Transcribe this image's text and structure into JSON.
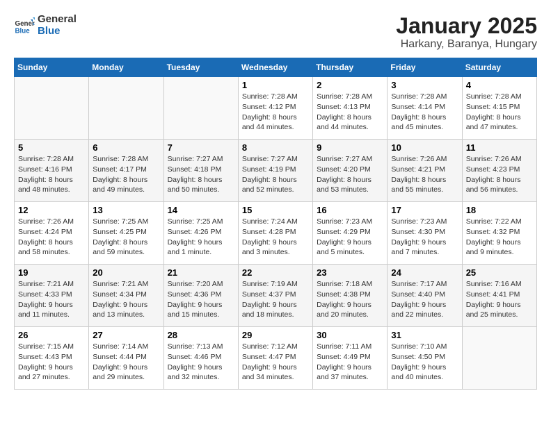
{
  "logo": {
    "line1": "General",
    "line2": "Blue"
  },
  "title": "January 2025",
  "subtitle": "Harkany, Baranya, Hungary",
  "headers": [
    "Sunday",
    "Monday",
    "Tuesday",
    "Wednesday",
    "Thursday",
    "Friday",
    "Saturday"
  ],
  "weeks": [
    [
      {
        "day": "",
        "info": ""
      },
      {
        "day": "",
        "info": ""
      },
      {
        "day": "",
        "info": ""
      },
      {
        "day": "1",
        "info": "Sunrise: 7:28 AM\nSunset: 4:12 PM\nDaylight: 8 hours\nand 44 minutes."
      },
      {
        "day": "2",
        "info": "Sunrise: 7:28 AM\nSunset: 4:13 PM\nDaylight: 8 hours\nand 44 minutes."
      },
      {
        "day": "3",
        "info": "Sunrise: 7:28 AM\nSunset: 4:14 PM\nDaylight: 8 hours\nand 45 minutes."
      },
      {
        "day": "4",
        "info": "Sunrise: 7:28 AM\nSunset: 4:15 PM\nDaylight: 8 hours\nand 47 minutes."
      }
    ],
    [
      {
        "day": "5",
        "info": "Sunrise: 7:28 AM\nSunset: 4:16 PM\nDaylight: 8 hours\nand 48 minutes."
      },
      {
        "day": "6",
        "info": "Sunrise: 7:28 AM\nSunset: 4:17 PM\nDaylight: 8 hours\nand 49 minutes."
      },
      {
        "day": "7",
        "info": "Sunrise: 7:27 AM\nSunset: 4:18 PM\nDaylight: 8 hours\nand 50 minutes."
      },
      {
        "day": "8",
        "info": "Sunrise: 7:27 AM\nSunset: 4:19 PM\nDaylight: 8 hours\nand 52 minutes."
      },
      {
        "day": "9",
        "info": "Sunrise: 7:27 AM\nSunset: 4:20 PM\nDaylight: 8 hours\nand 53 minutes."
      },
      {
        "day": "10",
        "info": "Sunrise: 7:26 AM\nSunset: 4:21 PM\nDaylight: 8 hours\nand 55 minutes."
      },
      {
        "day": "11",
        "info": "Sunrise: 7:26 AM\nSunset: 4:23 PM\nDaylight: 8 hours\nand 56 minutes."
      }
    ],
    [
      {
        "day": "12",
        "info": "Sunrise: 7:26 AM\nSunset: 4:24 PM\nDaylight: 8 hours\nand 58 minutes."
      },
      {
        "day": "13",
        "info": "Sunrise: 7:25 AM\nSunset: 4:25 PM\nDaylight: 8 hours\nand 59 minutes."
      },
      {
        "day": "14",
        "info": "Sunrise: 7:25 AM\nSunset: 4:26 PM\nDaylight: 9 hours\nand 1 minute."
      },
      {
        "day": "15",
        "info": "Sunrise: 7:24 AM\nSunset: 4:28 PM\nDaylight: 9 hours\nand 3 minutes."
      },
      {
        "day": "16",
        "info": "Sunrise: 7:23 AM\nSunset: 4:29 PM\nDaylight: 9 hours\nand 5 minutes."
      },
      {
        "day": "17",
        "info": "Sunrise: 7:23 AM\nSunset: 4:30 PM\nDaylight: 9 hours\nand 7 minutes."
      },
      {
        "day": "18",
        "info": "Sunrise: 7:22 AM\nSunset: 4:32 PM\nDaylight: 9 hours\nand 9 minutes."
      }
    ],
    [
      {
        "day": "19",
        "info": "Sunrise: 7:21 AM\nSunset: 4:33 PM\nDaylight: 9 hours\nand 11 minutes."
      },
      {
        "day": "20",
        "info": "Sunrise: 7:21 AM\nSunset: 4:34 PM\nDaylight: 9 hours\nand 13 minutes."
      },
      {
        "day": "21",
        "info": "Sunrise: 7:20 AM\nSunset: 4:36 PM\nDaylight: 9 hours\nand 15 minutes."
      },
      {
        "day": "22",
        "info": "Sunrise: 7:19 AM\nSunset: 4:37 PM\nDaylight: 9 hours\nand 18 minutes."
      },
      {
        "day": "23",
        "info": "Sunrise: 7:18 AM\nSunset: 4:38 PM\nDaylight: 9 hours\nand 20 minutes."
      },
      {
        "day": "24",
        "info": "Sunrise: 7:17 AM\nSunset: 4:40 PM\nDaylight: 9 hours\nand 22 minutes."
      },
      {
        "day": "25",
        "info": "Sunrise: 7:16 AM\nSunset: 4:41 PM\nDaylight: 9 hours\nand 25 minutes."
      }
    ],
    [
      {
        "day": "26",
        "info": "Sunrise: 7:15 AM\nSunset: 4:43 PM\nDaylight: 9 hours\nand 27 minutes."
      },
      {
        "day": "27",
        "info": "Sunrise: 7:14 AM\nSunset: 4:44 PM\nDaylight: 9 hours\nand 29 minutes."
      },
      {
        "day": "28",
        "info": "Sunrise: 7:13 AM\nSunset: 4:46 PM\nDaylight: 9 hours\nand 32 minutes."
      },
      {
        "day": "29",
        "info": "Sunrise: 7:12 AM\nSunset: 4:47 PM\nDaylight: 9 hours\nand 34 minutes."
      },
      {
        "day": "30",
        "info": "Sunrise: 7:11 AM\nSunset: 4:49 PM\nDaylight: 9 hours\nand 37 minutes."
      },
      {
        "day": "31",
        "info": "Sunrise: 7:10 AM\nSunset: 4:50 PM\nDaylight: 9 hours\nand 40 minutes."
      },
      {
        "day": "",
        "info": ""
      }
    ]
  ]
}
